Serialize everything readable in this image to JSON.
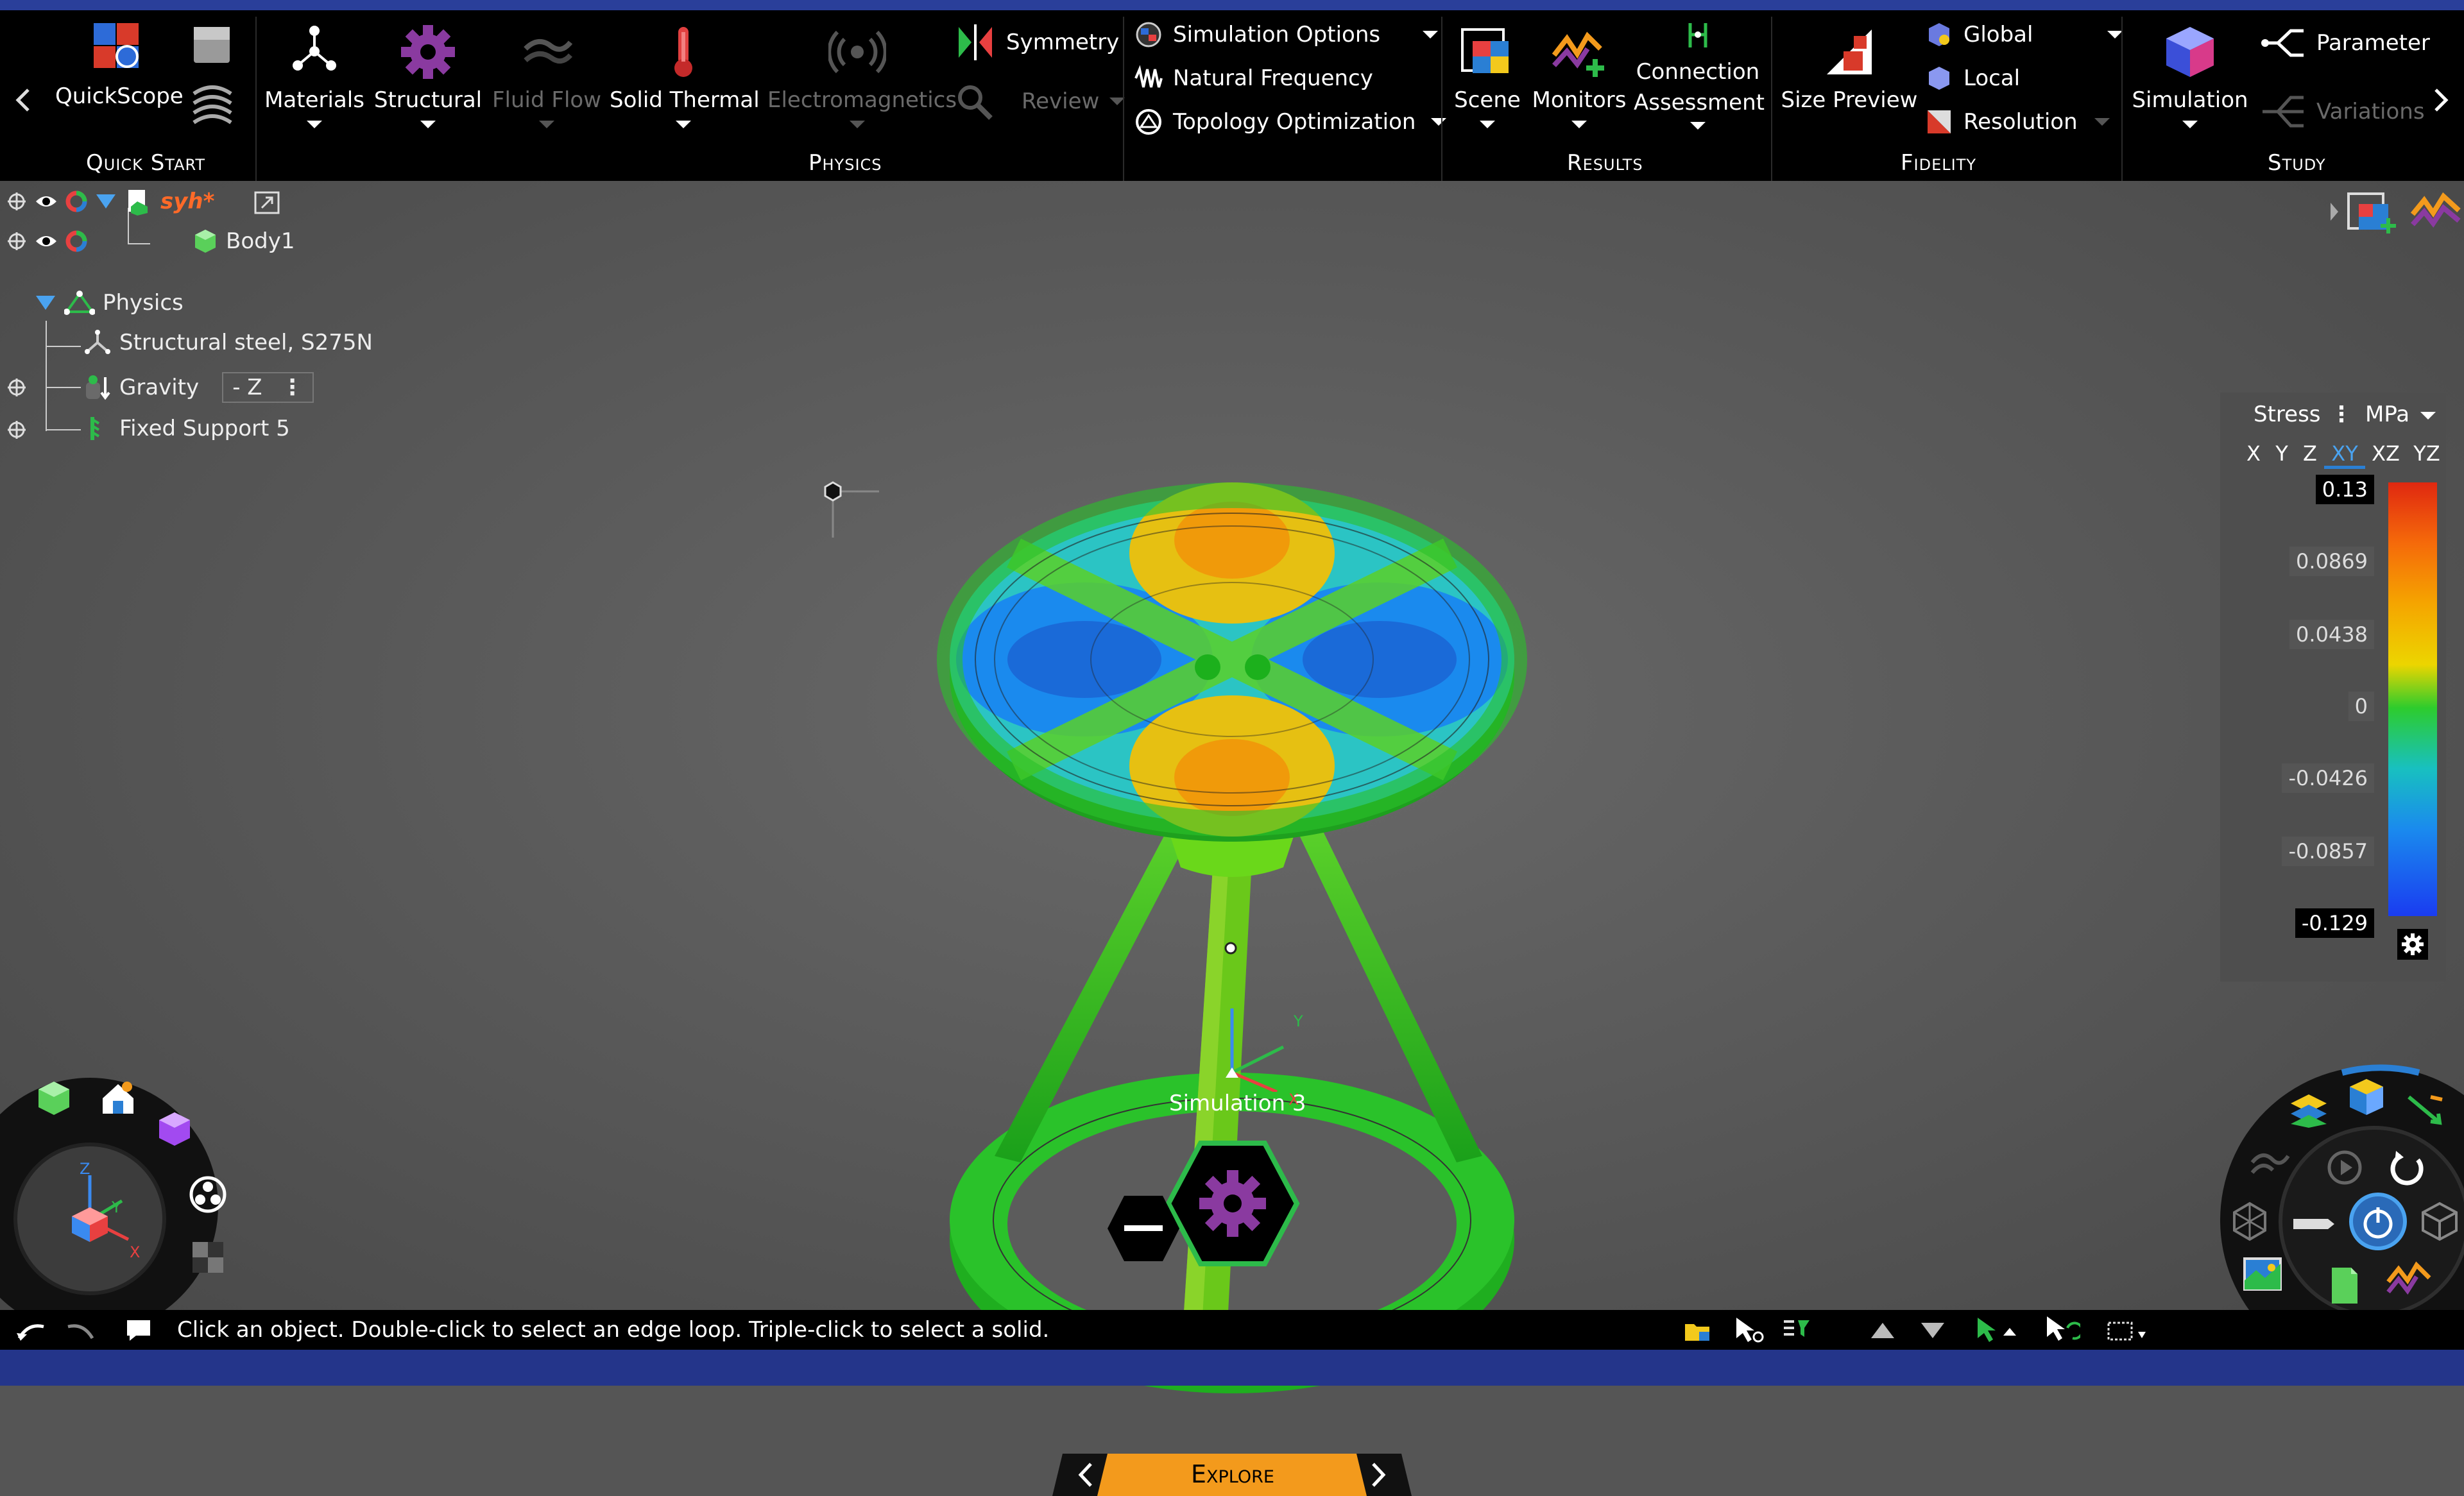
{
  "ribbon": {
    "quick_start": {
      "group_label": "Quick Start",
      "quickscope_label": "QuickScope"
    },
    "physics": {
      "group_label": "Physics",
      "materials": "Materials",
      "structural": "Structural",
      "fluid_flow": "Fluid Flow",
      "solid_thermal": "Solid Thermal",
      "electromagnetics": "Electromagnetics",
      "symmetry": "Symmetry",
      "review": "Review",
      "simulation_options": "Simulation Options",
      "natural_frequency": "Natural Frequency",
      "topology_optimization": "Topology Optimization"
    },
    "results": {
      "group_label": "Results",
      "scene": "Scene",
      "monitors": "Monitors",
      "connection_assessment": "Connection Assessment"
    },
    "fidelity": {
      "group_label": "Fidelity",
      "size_preview": "Size Preview",
      "global": "Global",
      "local": "Local",
      "resolution": "Resolution"
    },
    "study": {
      "group_label": "Study",
      "simulation": "Simulation",
      "parameter": "Parameter",
      "variations": "Variations"
    }
  },
  "tree": {
    "root": "syh*",
    "body": "Body1",
    "physics": "Physics",
    "material": "Structural steel, S275N",
    "gravity": "Gravity",
    "gravity_direction": "- Z",
    "fixed_support": "Fixed Support 5"
  },
  "legend": {
    "quantity": "Stress",
    "unit": "MPa",
    "components": [
      "X",
      "Y",
      "Z",
      "XY",
      "XZ",
      "YZ"
    ],
    "active_component": "XY",
    "ticks": [
      "0.13",
      "0.0869",
      "0.0438",
      "0",
      "-0.0426",
      "-0.0857",
      "-0.129"
    ],
    "gradient_colors": [
      "#e02810",
      "#f56a0a",
      "#f5a500",
      "#ecd500",
      "#2dcc2d",
      "#18c0c0",
      "#1a8aee",
      "#1a3cf0"
    ]
  },
  "viewport": {
    "simulation_label": "Simulation 3",
    "axis_x": "X",
    "axis_y": "Y",
    "axis_z": "Z"
  },
  "mode": {
    "explore_label": "Explore"
  },
  "status": {
    "message": "Click an object. Double-click to select an edge loop. Triple-click to select a solid."
  },
  "colors": {
    "ribbon_bg": "#000000",
    "accent_orange": "#f39a1c",
    "accent_blue": "#2a7fd4",
    "structural_purple": "#8a3aa0",
    "title_orange": "#ff6a28"
  }
}
